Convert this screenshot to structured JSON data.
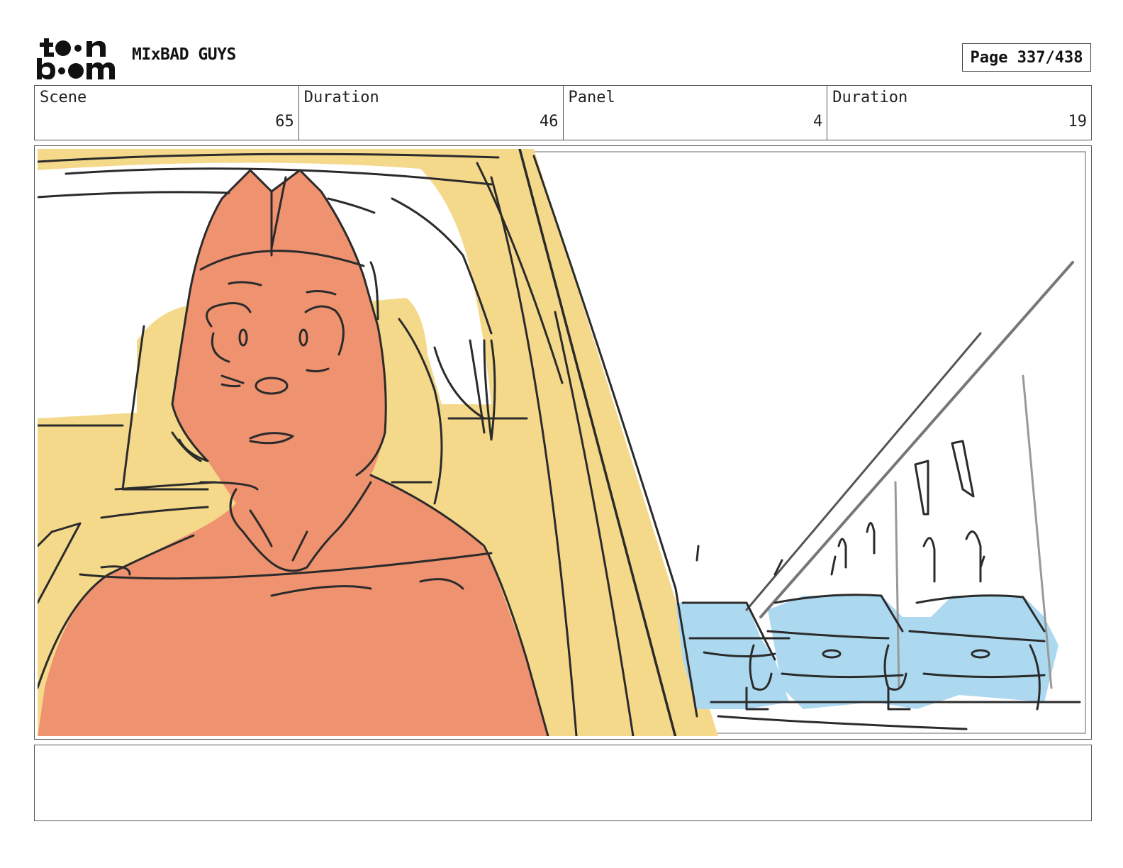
{
  "header": {
    "logo_alt": "toon boom",
    "project_title": "MIxBAD GUYS",
    "page_label": "Page 337/438"
  },
  "info": {
    "scene_label": "Scene",
    "scene_value": "65",
    "scene_duration_label": "Duration",
    "scene_duration_value": "46",
    "panel_label": "Panel",
    "panel_value": "4",
    "panel_duration_label": "Duration",
    "panel_duration_value": "19"
  },
  "panel": {
    "image_name": "storyboard-sketch",
    "colors": {
      "character": "#ef9270",
      "car_interior": "#f5d98b",
      "police_cars": "#acd9f0",
      "line": "#2b2b2b"
    }
  },
  "notes": {
    "text": ""
  }
}
